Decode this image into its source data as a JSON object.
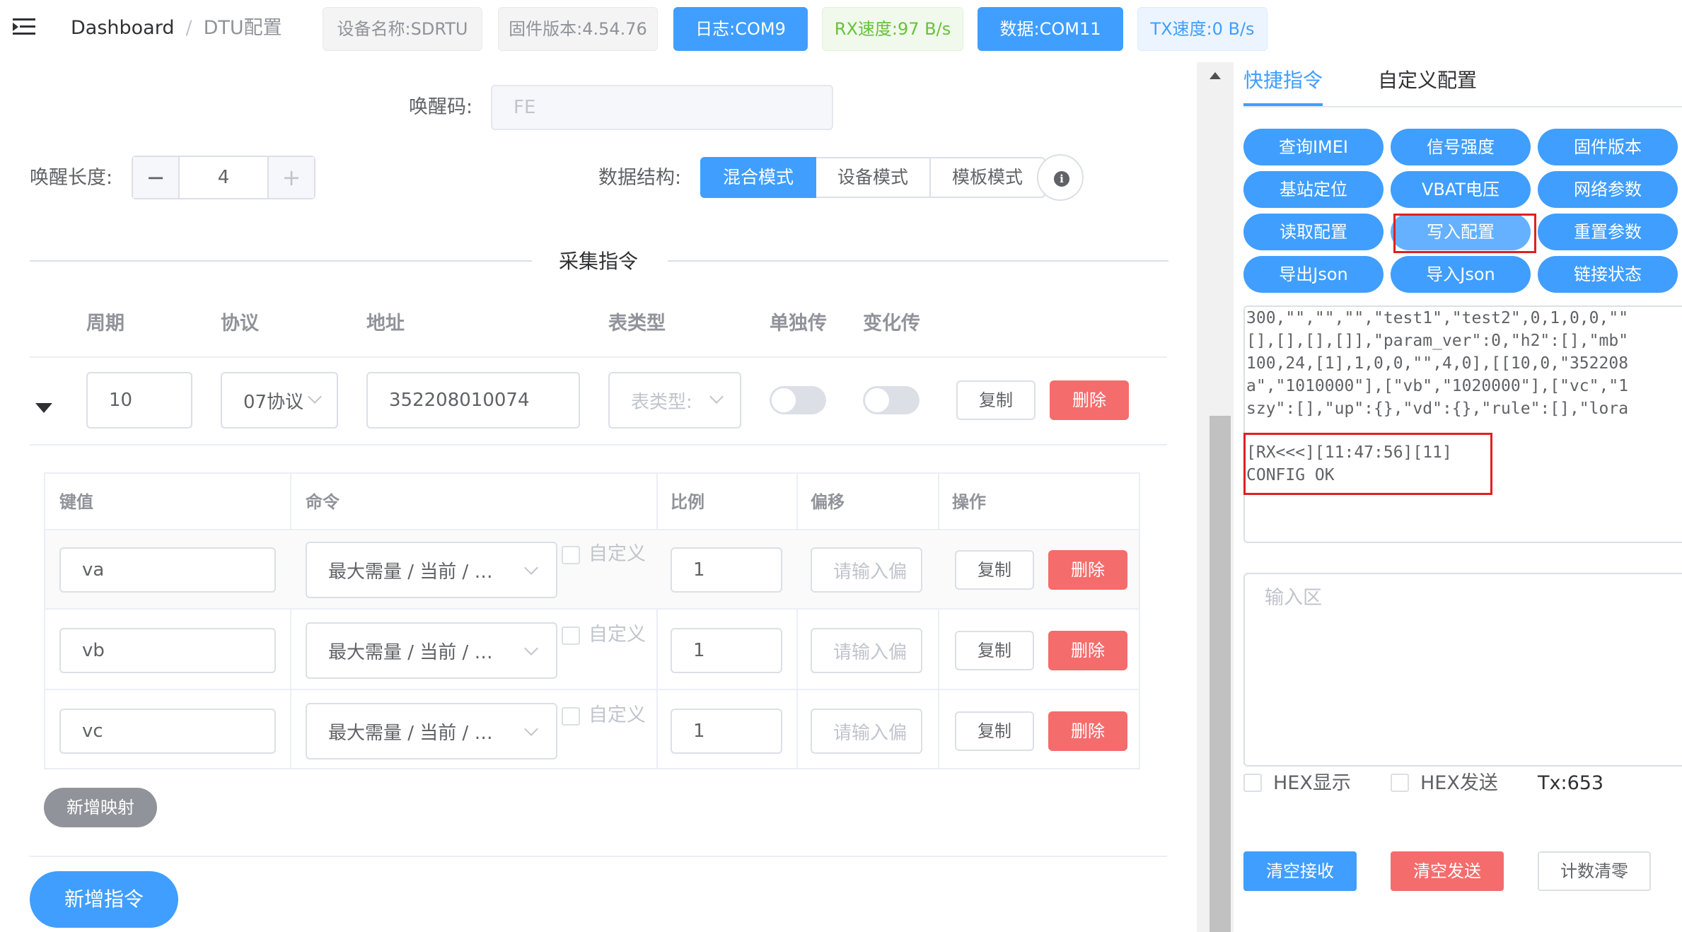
{
  "header": {
    "breadcrumb": [
      "Dashboard",
      "DTU配置"
    ],
    "tags": {
      "device_name": "设备名称:SDRTU",
      "firmware": "固件版本:4.54.76",
      "log_port": "日志:COM9",
      "rx_speed": "RX速度:97 B/s",
      "data_port": "数据:COM11",
      "tx_speed": "TX速度:0 B/s"
    }
  },
  "config": {
    "wake_code_label": "唤醒码:",
    "wake_code_value": "FE",
    "wake_length_label": "唤醒长度:",
    "wake_length_value": "4",
    "stepper_minus": "−",
    "stepper_plus": "+",
    "data_structure_label": "数据结构:",
    "data_structure_options": [
      "混合模式",
      "设备模式",
      "模板模式"
    ],
    "data_structure_selected": "混合模式",
    "info_glyph": "i"
  },
  "collect": {
    "title": "采集指令",
    "columns": [
      "周期",
      "协议",
      "地址",
      "表类型",
      "单独传",
      "变化传"
    ],
    "row": {
      "period": "10",
      "protocol": "07协议",
      "address": "352208010074",
      "meter_type_placeholder": "表类型:",
      "single_send": false,
      "change_send": false,
      "copy_label": "复制",
      "delete_label": "删除"
    }
  },
  "mapping": {
    "columns": [
      "键值",
      "命令",
      "比例",
      "偏移",
      "操作"
    ],
    "rows": [
      {
        "key": "va",
        "command": "最大需量 / 当前 / …",
        "custom_label": "自定义",
        "ratio": "1",
        "offset_placeholder": "请输入偏",
        "copy": "复制",
        "delete": "删除"
      },
      {
        "key": "vb",
        "command": "最大需量 / 当前 / …",
        "custom_label": "自定义",
        "ratio": "1",
        "offset_placeholder": "请输入偏",
        "copy": "复制",
        "delete": "删除"
      },
      {
        "key": "vc",
        "command": "最大需量 / 当前 / …",
        "custom_label": "自定义",
        "ratio": "1",
        "offset_placeholder": "请输入偏",
        "copy": "复制",
        "delete": "删除"
      }
    ],
    "add_mapping_label": "新增映射"
  },
  "add_command_label": "新增指令",
  "right": {
    "tabs": [
      "快捷指令",
      "自定义配置"
    ],
    "active_tab": "快捷指令",
    "commands": [
      "查询IMEI",
      "信号强度",
      "固件版本",
      "基站定位",
      "VBAT电压",
      "网络参数",
      "读取配置",
      "写入配置",
      "重置参数",
      "导出Json",
      "导入Json",
      "链接状态"
    ],
    "highlighted_command": "写入配置",
    "log_lines": [
      "300,\"\",\"\",\"\",\"test1\",\"test2\",0,1,0,0,\"\"",
      "[],[],[],[]],\"param_ver\":0,\"h2\":[],\"mb\"",
      "100,24,[1],1,0,0,\"\",4,0],[[10,0,\"352208",
      "a\",\"1010000\"],[\"vb\",\"1020000\"],[\"vc\",\"1",
      "szy\":[],\"up\":{},\"vd\":{},\"rule\":[],\"lora",
      "",
      "[RX<<<][11:47:56][11]",
      "CONFIG OK"
    ],
    "input_placeholder": "输入区",
    "hex_display_label": "HEX显示",
    "hex_send_label": "HEX发送",
    "tx_count": "Tx:653",
    "clear_receive_label": "清空接收",
    "clear_send_label": "清空发送",
    "reset_count_label": "计数清零"
  },
  "colors": {
    "primary": "#409eff",
    "danger": "#f56c6c",
    "success": "#67c23a",
    "info": "#909399",
    "highlight_box": "#e02020"
  }
}
